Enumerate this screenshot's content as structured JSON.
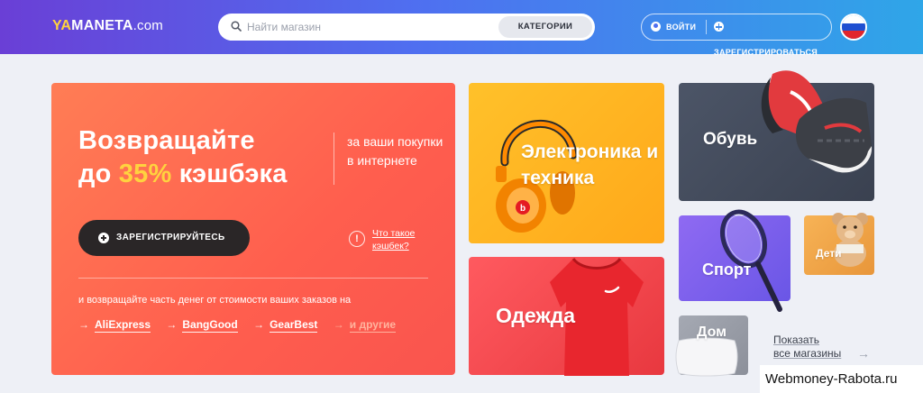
{
  "header": {
    "logo": {
      "ya": "YA",
      "rest": "MANETA",
      "domain": ".com"
    },
    "search": {
      "placeholder": "Найти магазин",
      "value": "",
      "categories_label": "КАТЕГОРИИ"
    },
    "auth": {
      "login_label": "ВОЙТИ",
      "register_label": "ЗАРЕГИСТРИРОВАТЬСЯ"
    },
    "language_flag": "russia-flag-icon"
  },
  "hero": {
    "title_line1": "Возвращайте",
    "title_line2_pre": "до ",
    "title_highlight": "35%",
    "title_line2_post": " кэшбэка",
    "subtitle": "за ваши покупки в интернете",
    "cta_label": "ЗАРЕГИСТРИРУЙТЕСЬ",
    "what_is_cashback": "Что такое кэшбек?",
    "note": "и возвращайте часть денег от стоимости ваших заказов на",
    "stores": [
      "AliExpress",
      "BangGood",
      "GearBest"
    ],
    "other_label": "и другие"
  },
  "categories": {
    "electronics": "Электроника и техника",
    "shoes": "Обувь",
    "clothes": "Одежда",
    "sport": "Спорт",
    "kids": "Дети",
    "home": "Дом"
  },
  "show_all": {
    "line1": "Показать",
    "line2": "все магазины"
  },
  "watermark": "Webmoney-Rabota.ru",
  "colors": {
    "header_gradient": [
      "#6a3fd6",
      "#2fa6e8"
    ],
    "hero": "#ff6a4f",
    "accent_yellow": "#ffd23f",
    "cta": "#2a2627",
    "electronics": "#ffb321",
    "shoes": "#434a5a",
    "clothes": "#f04a50",
    "sport": "#7c60ec",
    "kids": "#f0a548",
    "home": "#9a9ea8"
  }
}
